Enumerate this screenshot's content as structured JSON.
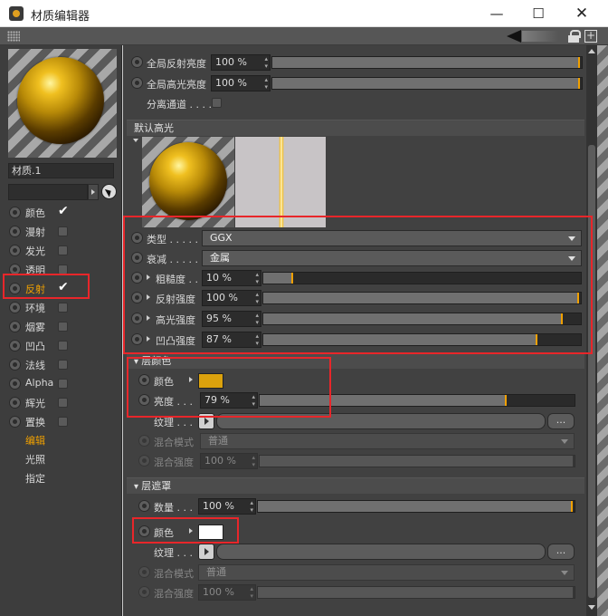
{
  "window": {
    "title": "材质编辑器",
    "min": "—",
    "max": "☐",
    "close": "✕"
  },
  "material": {
    "name": "材质.1"
  },
  "channels": [
    {
      "label": "颜色",
      "checked": true
    },
    {
      "label": "漫射",
      "checked": false
    },
    {
      "label": "发光",
      "checked": false
    },
    {
      "label": "透明",
      "checked": false
    },
    {
      "label": "反射",
      "checked": true,
      "active": true
    },
    {
      "label": "环境",
      "checked": false
    },
    {
      "label": "烟雾",
      "checked": false
    },
    {
      "label": "凹凸",
      "checked": false
    },
    {
      "label": "法线",
      "checked": false
    },
    {
      "label": "Alpha",
      "checked": false
    },
    {
      "label": "辉光",
      "checked": false
    },
    {
      "label": "置换",
      "checked": false
    }
  ],
  "sub_items": [
    "编辑",
    "光照",
    "指定"
  ],
  "top_params": {
    "global_reflect": {
      "label": "全局反射亮度",
      "value": "100 %",
      "fill": 1.0
    },
    "global_spec": {
      "label": "全局高光亮度",
      "value": "100 %",
      "fill": 1.0
    },
    "separate_pass": {
      "label": "分离通道 . . . ."
    }
  },
  "default_spec": {
    "title": "默认高光"
  },
  "specular": {
    "type": {
      "label": "类型 . . . . .",
      "value": "GGX"
    },
    "attenuation": {
      "label": "衰减 . . . . .",
      "value": "金属"
    },
    "roughness": {
      "label": "粗糙度 . .",
      "value": "10 %",
      "fill": 0.1
    },
    "reflect_strength": {
      "label": "反射强度",
      "value": "100 %",
      "fill": 1.0
    },
    "spec_strength": {
      "label": "高光强度",
      "value": "95 %",
      "fill": 0.95
    },
    "bump_strength": {
      "label": "凹凸强度",
      "value": "87 %",
      "fill": 0.87
    }
  },
  "layer_color": {
    "title": "层颜色",
    "color": {
      "label": "颜色",
      "swatch": "#dba20d"
    },
    "brightness": {
      "label": "亮度 . . .",
      "value": "79 %",
      "fill": 0.79
    },
    "texture": {
      "label": "纹理 . . .",
      "more": "..."
    },
    "blend_mode": {
      "label": "混合模式",
      "value": "普通"
    },
    "blend_strength": {
      "label": "混合强度",
      "value": "100 %",
      "fill": 1.0
    }
  },
  "layer_mask": {
    "title": "层遮罩",
    "amount": {
      "label": "数量 . . .",
      "value": "100 %",
      "fill": 1.0
    },
    "color": {
      "label": "颜色",
      "swatch": "#ffffff"
    },
    "texture": {
      "label": "纹理 . . .",
      "more": "..."
    },
    "blend_mode": {
      "label": "混合模式",
      "value": "普通"
    },
    "blend_strength": {
      "label": "混合强度",
      "value": "100 %",
      "fill": 1.0
    }
  },
  "colors": {
    "accent": "#f0a000",
    "highlight_box": "#e8262a",
    "gold": "#dba20d"
  }
}
